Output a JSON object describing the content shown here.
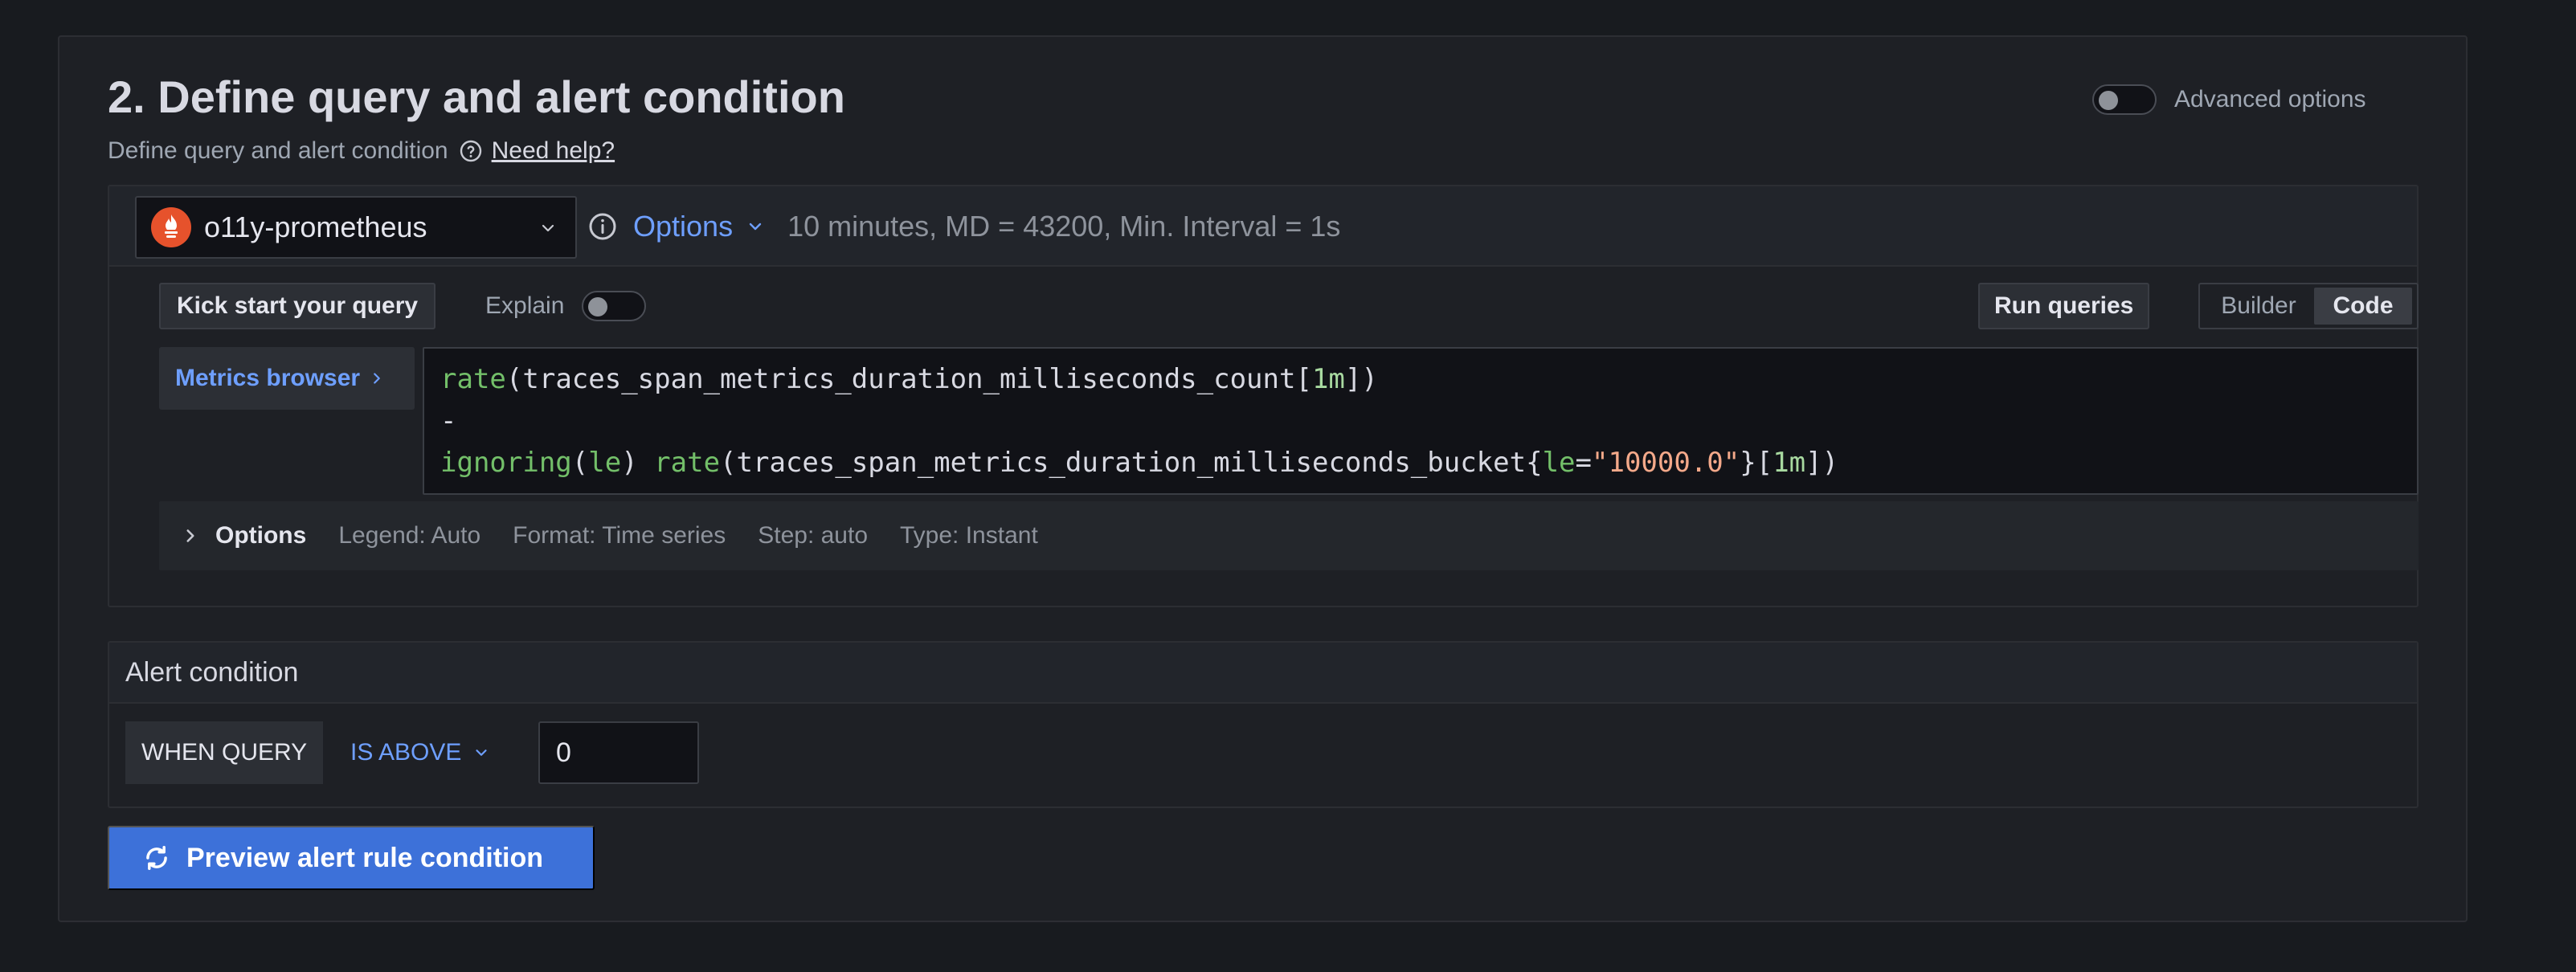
{
  "section": {
    "title": "2. Define query and alert condition",
    "subtitle": "Define query and alert condition",
    "help_link": "Need help?",
    "advanced_options_label": "Advanced options",
    "advanced_options_enabled": false
  },
  "query": {
    "datasource": {
      "name": "o11y-prometheus",
      "icon": "prometheus-logo",
      "color": "#e6522c"
    },
    "options_label": "Options",
    "options_summary": "10 minutes, MD = 43200, Min. Interval = 1s",
    "kick_start_label": "Kick start your query",
    "explain_label": "Explain",
    "explain_enabled": false,
    "run_queries_label": "Run queries",
    "modes": {
      "builder": "Builder",
      "code": "Code",
      "active": "Code"
    },
    "metrics_browser_label": "Metrics browser",
    "code": {
      "line1": {
        "fn": "rate",
        "open": "(",
        "metric": "traces_span_metrics_duration_milliseconds_count",
        "range_open": "[",
        "range": "1m",
        "close": "])"
      },
      "line2": "-",
      "line3": {
        "fn1": "ignoring",
        "open1": "(",
        "label": "le",
        "close1": ") ",
        "fn2": "rate",
        "open2": "(",
        "metric": "traces_span_metrics_duration_milliseconds_bucket",
        "brace_open": "{",
        "match_label": "le",
        "eq": "=",
        "match_value": "\"10000.0\"",
        "brace_close": "}",
        "range_open": "[",
        "range": "1m",
        "close": "])"
      }
    },
    "options_row": {
      "title": "Options",
      "legend": "Legend: Auto",
      "format": "Format: Time series",
      "step": "Step: auto",
      "type": "Type: Instant"
    }
  },
  "alert_condition": {
    "title": "Alert condition",
    "when_label": "WHEN QUERY",
    "operator": "IS ABOVE",
    "threshold_value": "0"
  },
  "preview_button_label": "Preview alert rule condition",
  "colors": {
    "accent": "#6e9fff",
    "primary_button": "#3d71d9",
    "background": "#181b1f"
  }
}
